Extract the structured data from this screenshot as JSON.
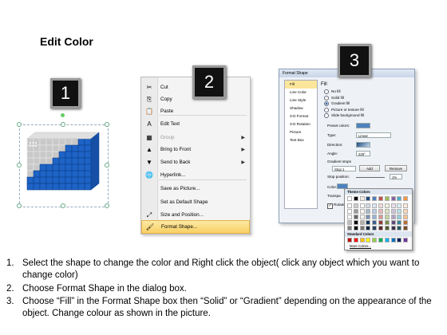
{
  "title": "Edit Color",
  "badges": [
    "1",
    "2",
    "3"
  ],
  "menu": {
    "items": [
      {
        "icon": "✂",
        "label": "Cut",
        "disabled": false,
        "submenu": false
      },
      {
        "icon": "⎘",
        "label": "Copy",
        "disabled": false,
        "submenu": false
      },
      {
        "icon": "📋",
        "label": "Paste",
        "disabled": false,
        "submenu": false
      },
      {
        "icon": "A",
        "label": "Edit Text",
        "disabled": false,
        "submenu": false
      },
      {
        "icon": "▦",
        "label": "Group",
        "disabled": true,
        "submenu": true
      },
      {
        "icon": "▲",
        "label": "Bring to Front",
        "disabled": false,
        "submenu": true
      },
      {
        "icon": "▼",
        "label": "Send to Back",
        "disabled": false,
        "submenu": true
      },
      {
        "icon": "🌐",
        "label": "Hyperlink...",
        "disabled": false,
        "submenu": false
      },
      {
        "icon": "",
        "label": "Save as Picture...",
        "disabled": false,
        "submenu": false
      },
      {
        "icon": "",
        "label": "Set as Default Shape",
        "disabled": false,
        "submenu": false
      },
      {
        "icon": "⤢",
        "label": "Size and Position...",
        "disabled": false,
        "submenu": false
      },
      {
        "icon": "🖌",
        "label": "Format Shape...",
        "disabled": false,
        "submenu": false,
        "highlighted": true
      }
    ]
  },
  "dialog": {
    "title": "Format Shape",
    "nav": [
      "Fill",
      "Line Color",
      "Line Style",
      "Shadow",
      "3-D Format",
      "3-D Rotation",
      "Picture",
      "Text Box"
    ],
    "section": "Fill",
    "options": [
      "No fill",
      "Solid fill",
      "Gradient fill",
      "Picture or texture fill",
      "Slide background fill"
    ],
    "selected_option": "Gradient fill",
    "preset_label": "Preset colors:",
    "type_label": "Type:",
    "type_value": "Linear",
    "direction_label": "Direction:",
    "angle_label": "Angle:",
    "angle_value": "225°",
    "stops_label": "Gradient stops",
    "stop_value": "Stop 1",
    "add_label": "Add",
    "remove_label": "Remove",
    "stop_position_label": "Stop position:",
    "stop_position_value": "1%",
    "color_label": "Color:",
    "transparency_label": "Transpa",
    "rotate_label": "Rotate"
  },
  "palette": {
    "theme_label": "Theme Colors",
    "standard_label": "Standard Colors",
    "more_label": "More Colors...",
    "theme_top": [
      "#ffffff",
      "#000000",
      "#eeece1",
      "#1f497d",
      "#4f81bd",
      "#c0504d",
      "#9bbb59",
      "#8064a2",
      "#4bacc6",
      "#f79646"
    ],
    "standard": [
      "#c00000",
      "#ff0000",
      "#ffc000",
      "#ffff00",
      "#92d050",
      "#00b050",
      "#00b0f0",
      "#0070c0",
      "#002060",
      "#7030a0"
    ]
  },
  "instructions": [
    {
      "num": "1.",
      "text": "Select the shape to change the color and Right click the object( click any object which you want to change color)"
    },
    {
      "num": "2.",
      "text": "Choose Format Shape in the dialog box."
    },
    {
      "num": "3.",
      "text": "Choose “Fill” in the Format Shape box then “Solid” or “Gradient” depending on the appearance of the object. Change colour as shown in the picture."
    }
  ]
}
